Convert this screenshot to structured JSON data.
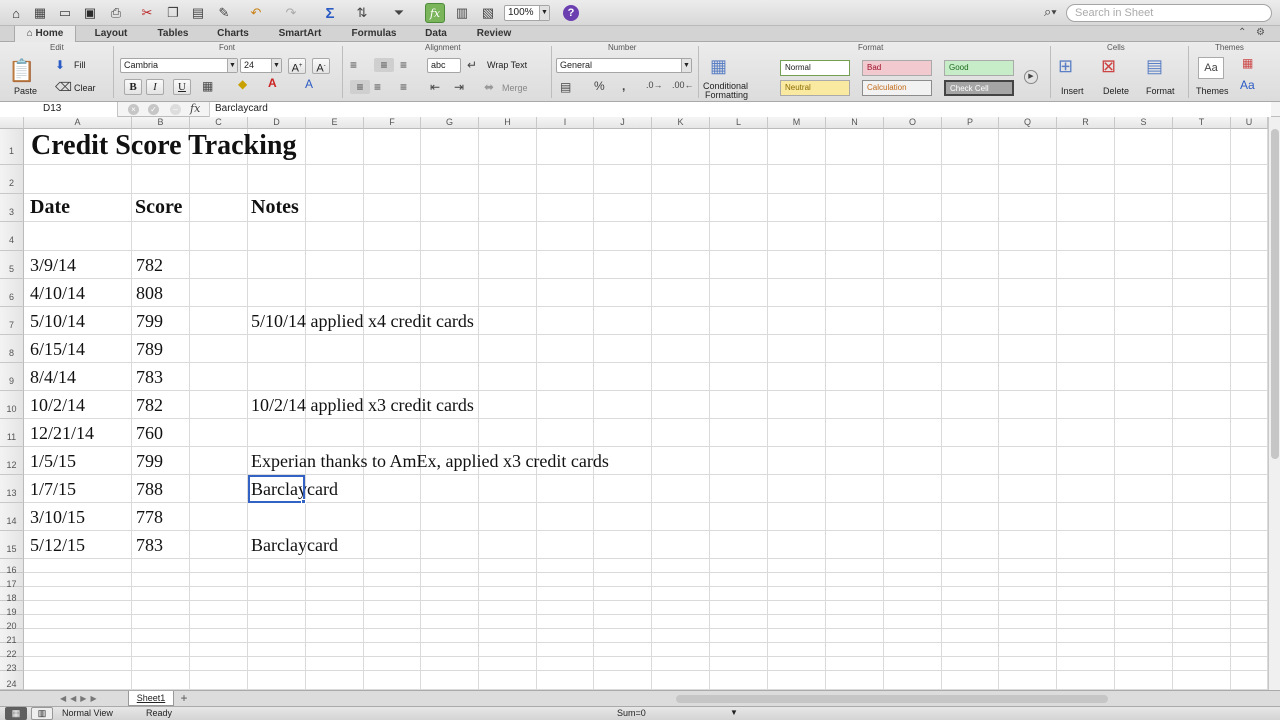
{
  "toolbar": {
    "zoom": "100%",
    "search_placeholder": "Search in Sheet"
  },
  "tabs": [
    {
      "label": "Home"
    },
    {
      "label": "Layout"
    },
    {
      "label": "Tables"
    },
    {
      "label": "Charts"
    },
    {
      "label": "SmartArt"
    },
    {
      "label": "Formulas"
    },
    {
      "label": "Data"
    },
    {
      "label": "Review"
    }
  ],
  "ribbon": {
    "groups": {
      "edit": "Edit",
      "font": "Font",
      "alignment": "Alignment",
      "number": "Number",
      "format": "Format",
      "cells": "Cells",
      "themes": "Themes"
    },
    "paste": "Paste",
    "fill": "Fill",
    "clear": "Clear",
    "font_name": "Cambria",
    "font_size": "24",
    "bold": "B",
    "italic": "I",
    "underline": "U",
    "wrap_text": "Wrap Text",
    "merge": "Merge",
    "abc": "abc",
    "number_format": "General",
    "percent": "%",
    "comma": ",",
    "conditional_formatting_1": "Conditional",
    "conditional_formatting_2": "Formatting",
    "styles": {
      "normal": "Normal",
      "bad": "Bad",
      "good": "Good",
      "neutral": "Neutral",
      "calculation": "Calculation",
      "check_cell": "Check Cell"
    },
    "insert": "Insert",
    "delete": "Delete",
    "format": "Format",
    "themes": "Themes",
    "theme_fonts": "Aa"
  },
  "formula_bar": {
    "name_box": "D13",
    "fx": "fx",
    "content": "Barclaycard"
  },
  "columns": [
    "A",
    "B",
    "C",
    "D",
    "E",
    "F",
    "G",
    "H",
    "I",
    "J",
    "K",
    "L",
    "M",
    "N",
    "O",
    "P",
    "Q",
    "R",
    "S",
    "T",
    "U"
  ],
  "rows": [
    "1",
    "2",
    "3",
    "4",
    "5",
    "6",
    "7",
    "8",
    "9",
    "10",
    "11",
    "12",
    "13",
    "14",
    "15",
    "16",
    "17",
    "18",
    "19",
    "20",
    "21",
    "22",
    "23",
    "24"
  ],
  "sheet": {
    "title": "Credit Score Tracking",
    "headers": {
      "date": "Date",
      "score": "Score",
      "notes": "Notes"
    },
    "data": [
      {
        "date": "3/9/14",
        "score": "782",
        "note": ""
      },
      {
        "date": "4/10/14",
        "score": "808",
        "note": ""
      },
      {
        "date": "5/10/14",
        "score": "799",
        "note": "5/10/14 applied x4 credit cards"
      },
      {
        "date": "6/15/14",
        "score": "789",
        "note": ""
      },
      {
        "date": "8/4/14",
        "score": "783",
        "note": ""
      },
      {
        "date": "10/2/14",
        "score": "782",
        "note": "10/2/14 applied x3 credit cards"
      },
      {
        "date": "12/21/14",
        "score": "760",
        "note": ""
      },
      {
        "date": "1/5/15",
        "score": "799",
        "note": "Experian thanks to AmEx, applied x3 credit cards"
      },
      {
        "date": "1/7/15",
        "score": "788",
        "note": "Barclaycard"
      },
      {
        "date": "3/10/15",
        "score": "778",
        "note": ""
      },
      {
        "date": "5/12/15",
        "score": "783",
        "note": "Barclaycard"
      }
    ]
  },
  "sheet_tab": "Sheet1",
  "status": {
    "view": "Normal View",
    "ready": "Ready",
    "sum": "Sum=0"
  }
}
